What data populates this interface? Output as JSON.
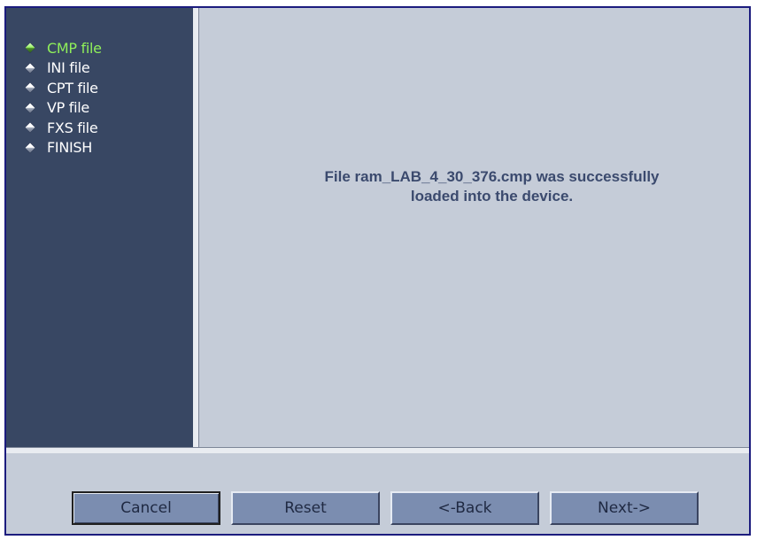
{
  "sidebar": {
    "items": [
      {
        "label": "CMP file",
        "active": true
      },
      {
        "label": "INI file",
        "active": false
      },
      {
        "label": "CPT file",
        "active": false
      },
      {
        "label": "VP file",
        "active": false
      },
      {
        "label": "FXS file",
        "active": false
      },
      {
        "label": "FINISH",
        "active": false
      }
    ]
  },
  "main": {
    "message_line1": "File ram_LAB_4_30_376.cmp was successfully",
    "message_line2": "loaded into the device."
  },
  "footer": {
    "cancel_label": "Cancel",
    "reset_label": "Reset",
    "back_label": "<-Back",
    "next_label": "Next->"
  },
  "colors": {
    "sidebar_bg": "#384763",
    "content_bg": "#c5ccd8",
    "active_item": "#8fef5a",
    "message_text": "#3b4a6e",
    "button_bg": "#7b8db0",
    "frame_border": "#1c1c7e"
  }
}
